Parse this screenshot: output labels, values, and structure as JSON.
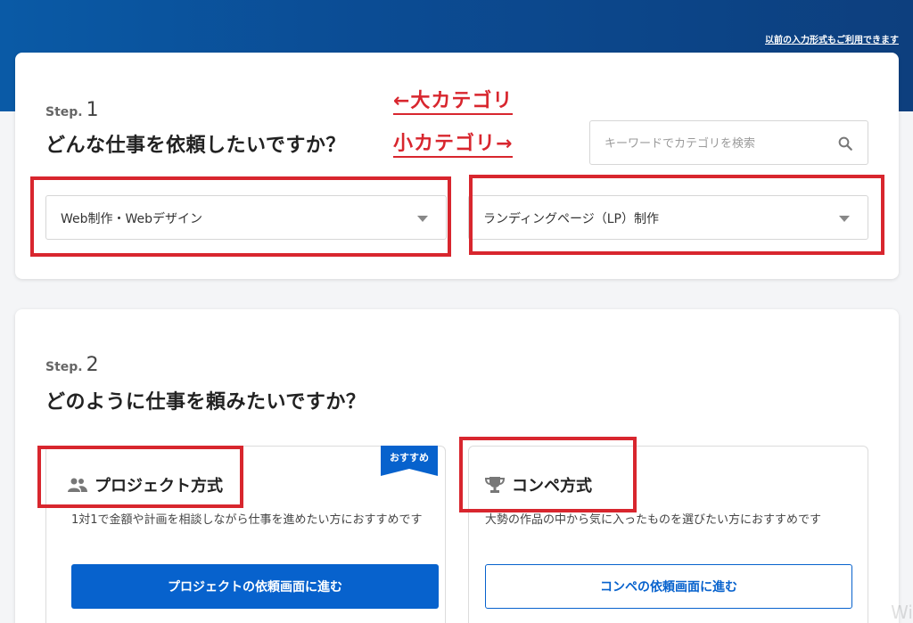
{
  "header": {
    "legacy_link": "以前の入力形式もご利用できます"
  },
  "step1": {
    "label": "Step.",
    "number": "1",
    "question": "どんな仕事を依頼したいですか？",
    "search_placeholder": "キーワードでカテゴリを検索",
    "major_category": {
      "value": "Web制作・Webデザイン"
    },
    "minor_category": {
      "value": "ランディングページ（LP）制作"
    }
  },
  "annotations": {
    "major": "←大カテゴリ",
    "minor": "小カテゴリ→",
    "color": "#d8262e"
  },
  "step2": {
    "label": "Step.",
    "number": "2",
    "question": "どのように仕事を頼みたいですか？",
    "project": {
      "title": "プロジェクト方式",
      "badge": "おすすめ",
      "description": "1対1で金額や計画を相談しながら仕事を進めたい方におすすめです",
      "button": "プロジェクトの依頼画面に進む",
      "icon": "users-icon"
    },
    "competition": {
      "title": "コンペ方式",
      "description": "大勢の作品の中から気に入ったものを選びたい方におすすめです",
      "button": "コンペの依頼画面に進む",
      "icon": "trophy-icon"
    }
  },
  "colors": {
    "primary": "#0762cd",
    "banner": "#0b4c94",
    "highlight": "#d8262e"
  },
  "watermark": "Wi"
}
